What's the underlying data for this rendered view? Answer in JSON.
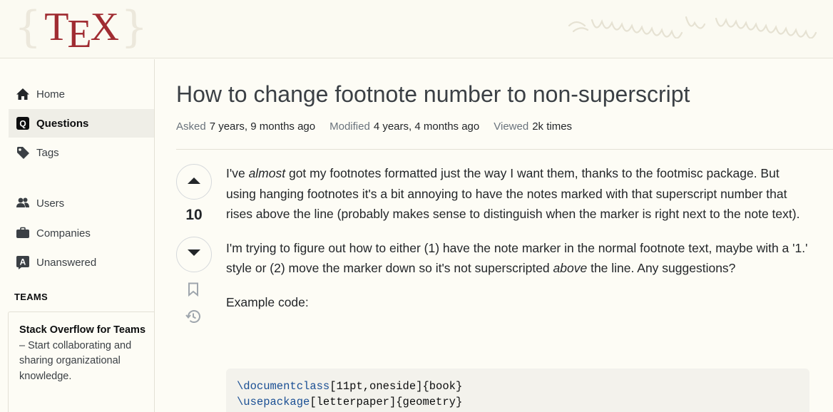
{
  "header": {
    "logo_text": "TEX",
    "logo_brace_left": "{",
    "logo_brace_right": "}",
    "decoration_text": "ᛟ ꞗᴧᴧᴧᴧᴧᴧᴧᴧᴧᴧᴧ ꞗᴧᴧᴧᴧᴧᴧᴧᴧ"
  },
  "sidebar": {
    "items": [
      {
        "label": "Home",
        "icon": "home-icon"
      },
      {
        "label": "Questions",
        "icon": "questions-icon",
        "active": true
      },
      {
        "label": "Tags",
        "icon": "tag-icon"
      },
      {
        "label": "Users",
        "icon": "users-icon"
      },
      {
        "label": "Companies",
        "icon": "briefcase-icon"
      },
      {
        "label": "Unanswered",
        "icon": "unanswered-icon"
      }
    ],
    "teams_heading": "TEAMS",
    "teams_promo": {
      "title": "Stack Overflow for Teams",
      "text": " – Start collaborating and sharing organizational knowledge."
    }
  },
  "question": {
    "title": "How to change footnote number to non-superscript",
    "meta": [
      {
        "label": "Asked",
        "value": "7 years, 9 months ago"
      },
      {
        "label": "Modified",
        "value": "4 years, 4 months ago"
      },
      {
        "label": "Viewed",
        "value": "2k times"
      }
    ],
    "votes": "10",
    "body": {
      "p1_a": "I've ",
      "p1_em": "almost",
      "p1_b": " got my footnotes formatted just the way I want them, thanks to the footmisc package. But using hanging footnotes it's a bit annoying to have the notes marked with that superscript number that rises above the line (probably makes sense to distinguish when the marker is right next to the note text).",
      "p2_a": "I'm trying to figure out how to either (1) have the note marker in the normal footnote text, maybe with a '1.' style or (2) move the marker down so it's not superscripted ",
      "p2_em": "above",
      "p2_b": " the line. Any suggestions?",
      "p3": "Example code:"
    },
    "code_lines": [
      {
        "cmd": "\\documentclass",
        "args": "[11pt,oneside]{book}"
      },
      {
        "cmd": "\\usepackage",
        "args": "[letterpaper]{geometry}"
      }
    ]
  },
  "colors": {
    "brand_red": "#a02c32",
    "page_bg": "#fdfcf5",
    "active_nav_bg": "#efeee7",
    "code_keyword": "#1a4f94"
  }
}
